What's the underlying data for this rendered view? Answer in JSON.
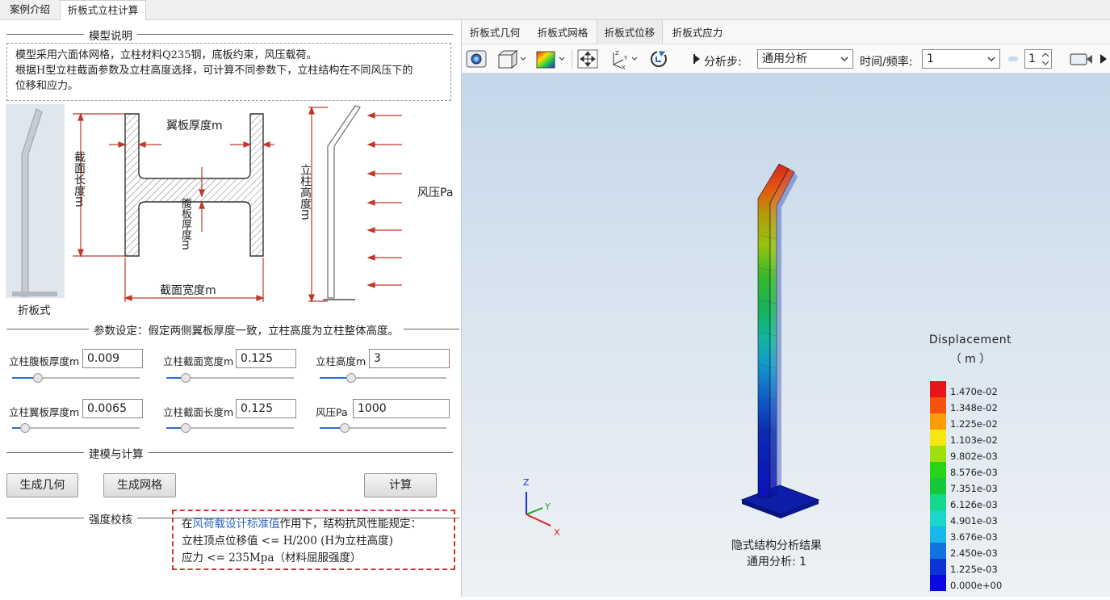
{
  "top_tabs": [
    "案例介绍",
    "折板式立柱计算"
  ],
  "left": {
    "section_model": "模型说明",
    "desc_line1": "模型采用六面体网格，立柱材料Q235钢，底板约束，风压载荷。",
    "desc_line2": "根据H型立柱截面参数及立柱高度选择，可计算不同参数下，立柱结构在不同风压下的",
    "desc_line3": "位移和应力。",
    "diagram": {
      "thumb_label": "折板式",
      "flange_thickness": "翼板厚度m",
      "section_length": "截面长度m",
      "web_thickness": "腹板厚度m",
      "section_width": "截面宽度m",
      "column_height": "立柱高度m",
      "wind_pressure": "风压Pa"
    },
    "section_params": "参数设定：假定两侧翼板厚度一致，立柱高度为立柱整体高度。",
    "params": [
      {
        "label": "立柱腹板厚度m",
        "value": "0.009",
        "slider": 0.2
      },
      {
        "label": "立柱截面宽度m",
        "value": "0.125",
        "slider": 0.15
      },
      {
        "label": "立柱高度m",
        "value": "3",
        "slider": 0.25
      },
      {
        "label": "立柱翼板厚度m",
        "value": "0.0065",
        "slider": 0.1
      },
      {
        "label": "立柱截面长度m",
        "value": "0.125",
        "slider": 0.15
      },
      {
        "label": "风压Pa",
        "value": "1000",
        "slider": 0.2
      }
    ],
    "section_build": "建模与计算",
    "btn_geom": "生成几何",
    "btn_mesh": "生成网格",
    "btn_calc": "计算",
    "section_check": "强度校核",
    "check_prefix": "在",
    "check_link": "风荷载设计标准值",
    "check_suffix": "作用下，结构抗风性能规定：",
    "check_line2": "立柱顶点位移值 <= H/200 (H为立柱高度)",
    "check_line3": "应力 <= 235Mpa（材料屈服强度）"
  },
  "right": {
    "tabs": [
      "折板式几何",
      "折板式网格",
      "折板式位移",
      "折板式应力"
    ],
    "active_tab": 2,
    "toolbar": {
      "step_label": "分析步:",
      "step_value": "通用分析",
      "time_label": "时间/频率:",
      "time_value": "1",
      "spin_value": "1"
    },
    "legend": {
      "title": "Displacement",
      "unit": "（ m ）",
      "values": [
        "1.470e-02",
        "1.348e-02",
        "1.225e-02",
        "1.103e-02",
        "9.802e-03",
        "8.576e-03",
        "7.351e-03",
        "6.126e-03",
        "4.901e-03",
        "3.676e-03",
        "2.450e-03",
        "1.225e-03",
        "0.000e+00"
      ],
      "colors": [
        "#e8141a",
        "#f5510f",
        "#fc9d08",
        "#f6e612",
        "#9ce10e",
        "#29d418",
        "#14c839",
        "#13da8b",
        "#1ad6cb",
        "#16b7ea",
        "#0f74e0",
        "#0a34d3",
        "#0a0ae0"
      ]
    },
    "caption_line1": "隐式结构分析结果",
    "caption_line2": "通用分析: 1",
    "axis": {
      "z": "Z",
      "y": "Y",
      "x": "X"
    }
  }
}
